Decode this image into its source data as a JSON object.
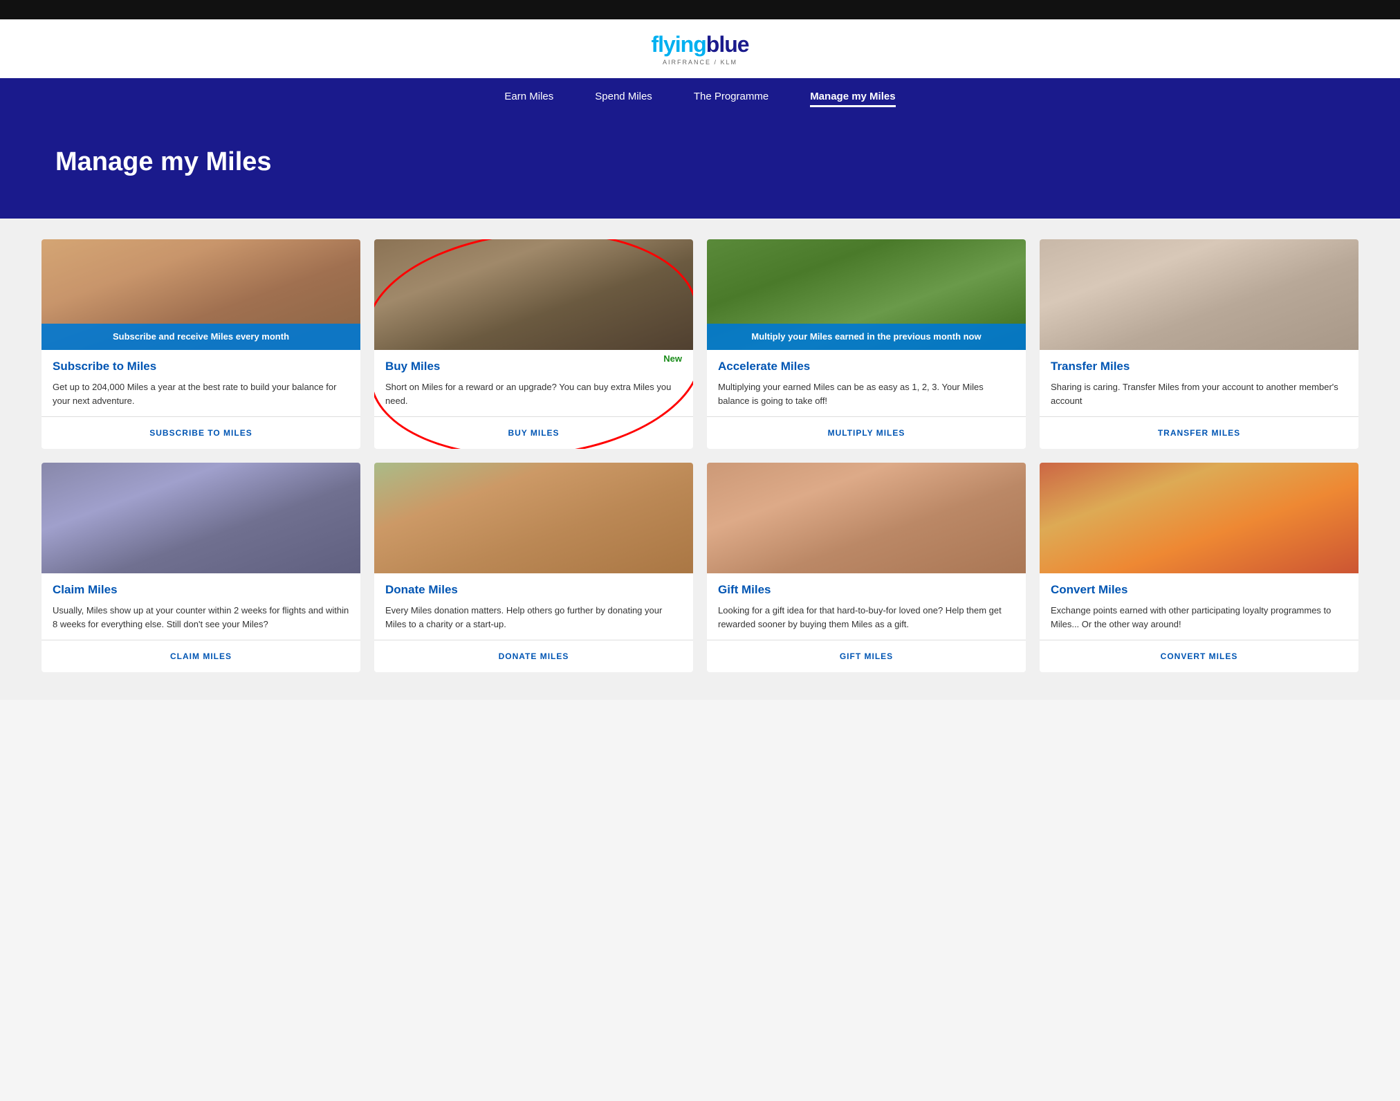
{
  "topbar": {},
  "header": {
    "logo_text": "flyingblue",
    "logo_sub": "AIRFRANCE / KLM"
  },
  "nav": {
    "items": [
      {
        "label": "Earn Miles",
        "active": false
      },
      {
        "label": "Spend Miles",
        "active": false
      },
      {
        "label": "The Programme",
        "active": false
      },
      {
        "label": "Manage my Miles",
        "active": true
      }
    ]
  },
  "hero": {
    "title": "Manage my Miles"
  },
  "cards": [
    {
      "id": "subscribe",
      "img_class": "img-woman-fitness",
      "overlay_text": "Subscribe and receive Miles every month",
      "overlay_style": "accent",
      "new_badge": false,
      "title": "Subscribe to Miles",
      "desc": "Get up to 204,000 Miles a year at the best rate to build your balance for your next adventure.",
      "cta": "SUBSCRIBE TO MILES",
      "circled": false
    },
    {
      "id": "buy",
      "img_class": "img-woman-laptop",
      "overlay_text": "",
      "overlay_style": "",
      "new_badge": true,
      "new_badge_text": "New",
      "title": "Buy Miles",
      "desc": "Short on Miles for a reward or an upgrade? You can buy extra Miles you need.",
      "cta": "BUY MILES",
      "circled": true
    },
    {
      "id": "accelerate",
      "img_class": "img-cyclists",
      "overlay_text": "Multiply your Miles earned in the previous month now",
      "overlay_style": "accent",
      "new_badge": false,
      "title": "Accelerate Miles",
      "desc": "Multiplying your earned Miles can be as easy as 1, 2, 3. Your Miles balance is going to take off!",
      "cta": "MULTIPLY MILES",
      "circled": false
    },
    {
      "id": "transfer",
      "img_class": "img-couple-phone",
      "overlay_text": "",
      "overlay_style": "",
      "new_badge": false,
      "title": "Transfer Miles",
      "desc": "Sharing is caring. Transfer Miles from your account to another member's account",
      "cta": "TRANSFER MILES",
      "circled": false
    },
    {
      "id": "claim",
      "img_class": "img-woman-street",
      "overlay_text": "",
      "overlay_style": "",
      "new_badge": false,
      "title": "Claim Miles",
      "desc": "Usually, Miles show up at your counter within 2 weeks for flights and within 8 weeks for everything else. Still don't see your Miles?",
      "cta": "CLAIM MILES",
      "circled": false
    },
    {
      "id": "donate",
      "img_class": "img-elderly-couple",
      "overlay_text": "",
      "overlay_style": "",
      "new_badge": false,
      "title": "Donate Miles",
      "desc": "Every Miles donation matters. Help others go further by donating your Miles to a charity or a start-up.",
      "cta": "DONATE MILES",
      "circled": false
    },
    {
      "id": "gift",
      "img_class": "img-women-friends",
      "overlay_text": "",
      "overlay_style": "",
      "new_badge": false,
      "title": "Gift Miles",
      "desc": "Looking for a gift idea for that hard-to-buy-for loved one? Help them get rewarded sooner by buying them Miles as a gift.",
      "cta": "GIFT MILES",
      "circled": false
    },
    {
      "id": "convert",
      "img_class": "img-friends-colorful",
      "overlay_text": "",
      "overlay_style": "",
      "new_badge": false,
      "title": "Convert Miles",
      "desc": "Exchange points earned with other participating loyalty programmes to Miles... Or the other way around!",
      "cta": "CONVERT MILES",
      "circled": false
    }
  ]
}
